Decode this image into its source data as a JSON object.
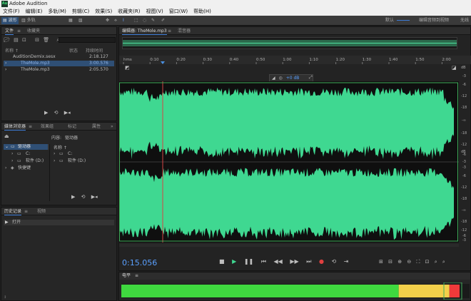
{
  "app": {
    "title": "Adobe Audition",
    "icon": "Au"
  },
  "menu": [
    "文件(F)",
    "编辑(E)",
    "多轨(M)",
    "剪辑(C)",
    "效果(S)",
    "收藏夹(R)",
    "视图(V)",
    "窗口(W)",
    "帮助(H)"
  ],
  "toolbar": {
    "waveform": "波形",
    "multitrack": "多轨",
    "workspace_label": "默认",
    "right_tab": "编辑音频到视频",
    "right_more": "无线"
  },
  "files": {
    "tab_files": "文件",
    "tab_favorites": "收藏夹",
    "col_name": "名称 ↑",
    "col_status": "状态",
    "col_duration": "持续时间",
    "items": [
      {
        "name": "AuditionDemix.sesx",
        "duration": "2:18.127",
        "selected": false
      },
      {
        "name": "TheMole.mp3",
        "duration": "3:00.576",
        "selected": true
      },
      {
        "name": "TheMole.mp3",
        "duration": "2:05.570",
        "selected": false
      }
    ]
  },
  "media": {
    "tab_browser": "媒体浏览器",
    "tab_effects": "效果组",
    "tab_markers": "标记",
    "tab_props": "属性",
    "content_label": "内容:",
    "content_value": "驱动器",
    "col_name": "名称 ↑",
    "tree": [
      {
        "label": "驱动器",
        "selected": true
      },
      {
        "label": "C:",
        "selected": false
      },
      {
        "label": "软件 (D:)",
        "selected": false
      },
      {
        "label": "快捷键",
        "selected": false
      }
    ],
    "right_list": [
      "C:",
      "软件 (D:)"
    ]
  },
  "history": {
    "tab_history": "历史记录",
    "tab_video": "视频",
    "item": "打开"
  },
  "editor": {
    "tab": "编辑器: TheMole.mp3",
    "tab_mixer": "混音器",
    "timecode": "0:15.056",
    "gain_value": "+0 dB",
    "ruler": [
      "hms",
      "0:10",
      "0:20",
      "0:30",
      "0:40",
      "0:50",
      "1:00",
      "1:10",
      "1:20",
      "1:30",
      "1:40",
      "1:50",
      "2:00"
    ],
    "db_upper": [
      "dB",
      "-3",
      "-6",
      "-12",
      "-18",
      "-∞",
      "-18",
      "-12",
      "-6",
      "-3"
    ],
    "db_lower": [
      "dB",
      "-3",
      "-6",
      "-12",
      "-18",
      "-∞",
      "-18",
      "-12",
      "-6",
      "-3"
    ]
  },
  "levels": {
    "label": "电平",
    "green_fraction": 0.82,
    "yellow_fraction": 0.15,
    "red_fraction": 0.03
  },
  "colors": {
    "waveform": "#3fd891",
    "selection": "#2f4f75",
    "accent": "#3c7bd6",
    "playhead": "#d64545"
  }
}
